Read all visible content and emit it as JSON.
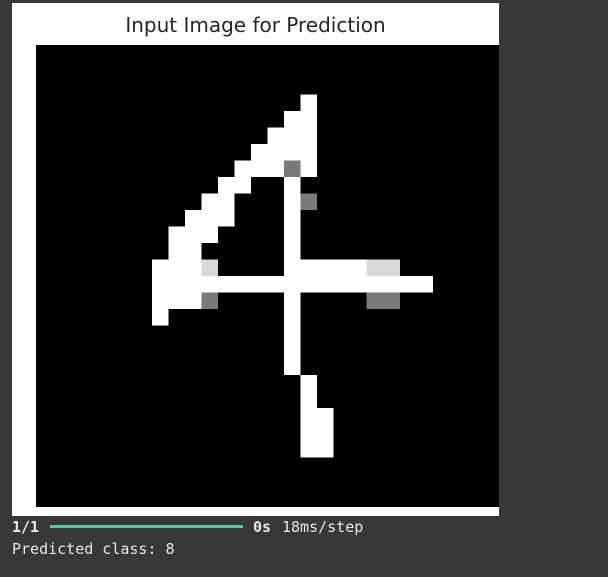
{
  "figure": {
    "title": "Input Image for Prediction",
    "digit_image": {
      "grid": "28x28",
      "colormap": "gray",
      "axis": "off",
      "pixel_rows": [
        "............................",
        "............................",
        "............................",
        "................W...........",
        "...............WW...........",
        "..............WWW...........",
        ".............WWWW...........",
        "............WWWGW...........",
        "...........WW..W............",
        "..........WW...WG...........",
        ".........WWW...W............",
        "........WWW....W............",
        "........WW.....W............",
        ".......WWWL....WWWWWLL......",
        ".......WWWWWWWWWWWWWWWWW....",
        ".......WWWG....W....GG......",
        ".......W.......W............",
        "...............W............",
        "...............W............",
        "...............W............",
        "................W...........",
        "................W...........",
        "................WW..........",
        "................WW..........",
        "................WW..........",
        "............................",
        "............................",
        "............................"
      ]
    }
  },
  "output": {
    "progress": {
      "steps": "1/1",
      "fraction": 1.0,
      "elapsed": "0s",
      "step_time": "18ms/step"
    },
    "prediction": "Predicted class: 8"
  },
  "colors": {
    "background": "#383838",
    "panel": "#ffffff",
    "progress_fill": "#60c79b",
    "text": "#e8e8e8"
  }
}
